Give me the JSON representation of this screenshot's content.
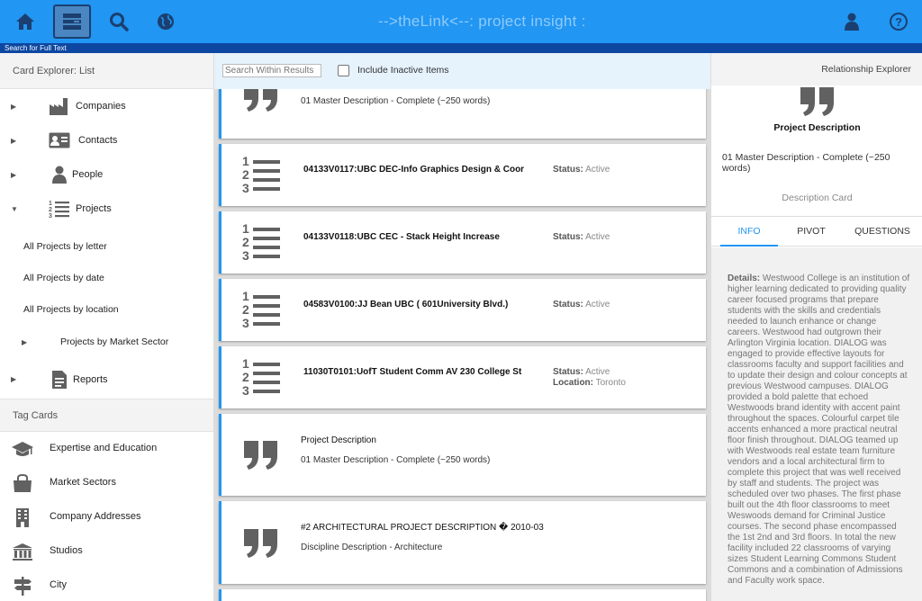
{
  "topbar": {
    "title": "-->theLink<--: project insight :",
    "search_hint": "Search for Full Text",
    "buttons": [
      {
        "icon": "home-icon"
      },
      {
        "icon": "card-list-icon",
        "active": true
      },
      {
        "icon": "search-icon"
      },
      {
        "icon": "globe-icon"
      },
      {
        "icon": "user-icon"
      },
      {
        "icon": "help-icon"
      }
    ]
  },
  "sidebar": {
    "header": "Card Explorer: List",
    "items": [
      {
        "label": "Companies",
        "icon": "factory-icon"
      },
      {
        "label": "Contacts",
        "icon": "contact-card-icon"
      },
      {
        "label": "People",
        "icon": "person-icon"
      },
      {
        "label": "Projects",
        "icon": "numbered-list-icon",
        "expanded": true
      }
    ],
    "project_subitems": [
      "All Projects by letter",
      "All Projects by date",
      "All Projects by location"
    ],
    "market_sector": "Projects by Market Sector",
    "reports": "Reports",
    "tag_header": "Tag Cards",
    "tags": [
      {
        "label": "Expertise and Education",
        "icon": "graduation-cap-icon"
      },
      {
        "label": "Market Sectors",
        "icon": "shopping-bag-icon"
      },
      {
        "label": "Company Addresses",
        "icon": "building-icon"
      },
      {
        "label": "Studios",
        "icon": "institution-icon"
      },
      {
        "label": "City",
        "icon": "signpost-icon"
      }
    ]
  },
  "center": {
    "search_placeholder": "Search Within Results",
    "include_inactive": "Include Inactive Items",
    "cards": [
      {
        "type": "quote",
        "subtitle": "01 Master Description - Complete (~250 words)"
      },
      {
        "type": "project",
        "title": "04133V0117:UBC DEC-Info Graphics Design & Coor",
        "status_label": "Status:",
        "status": "Active"
      },
      {
        "type": "project",
        "title": "04133V0118:UBC CEC - Stack Height Increase",
        "status_label": "Status:",
        "status": "Active"
      },
      {
        "type": "project",
        "title": "04583V0100:JJ Bean UBC ( 601University Blvd.)",
        "status_label": "Status:",
        "status": "Active"
      },
      {
        "type": "project",
        "title": "11030T0101:UofT Student Comm AV 230 College St",
        "status_label": "Status:",
        "status": "Active",
        "location_label": "Location:",
        "location": "Toronto"
      },
      {
        "type": "quote",
        "title": "Project Description",
        "subtitle": "01 Master Description - Complete (~250 words)"
      },
      {
        "type": "quote",
        "title": "#2 ARCHITECTURAL PROJECT DESCRIPTION � 2010-03",
        "subtitle": "Discipline Description - Architecture"
      }
    ]
  },
  "right_panel": {
    "header": "Relationship Explorer",
    "title": "Project Description",
    "description": "01 Master Description - Complete (~250 words)",
    "card_type": "Description Card",
    "tabs": [
      "INFO",
      "PIVOT",
      "QUESTIONS"
    ],
    "active_tab": "INFO",
    "details_label": "Details:",
    "details_text": "Westwood College is an institution of higher learning dedicated to providing quality career focused programs that prepare students with the skills and credentials needed to launch enhance or change careers. Westwood had outgrown their Arlington Virginia location. DIALOG was engaged to provide effective layouts for classrooms faculty and support facilities and to update their design and colour concepts at previous Westwood campuses. DIALOG provided a bold palette that echoed Westwoods brand identity with accent paint throughout the spaces. Colourful carpet tile accents enhanced a more practical neutral floor finish throughout. DIALOG teamed up with Westwoods real estate team furniture vendors and a local architectural firm to complete this project that was well received by staff and students. The project was scheduled over two phases. The first phase built out the 4th floor classrooms to meet Weswoods demand for Criminal Justice courses. The second phase encompassed the 1st 2nd and 3rd floors. In total the new facility included 22 classrooms of varying sizes Student Learning Commons Student Commons and a combination of Admissions and Faculty work space."
  },
  "colors": {
    "primary": "#2196f3",
    "dark_blue": "#0d47a1",
    "icon_gray": "#616161"
  }
}
